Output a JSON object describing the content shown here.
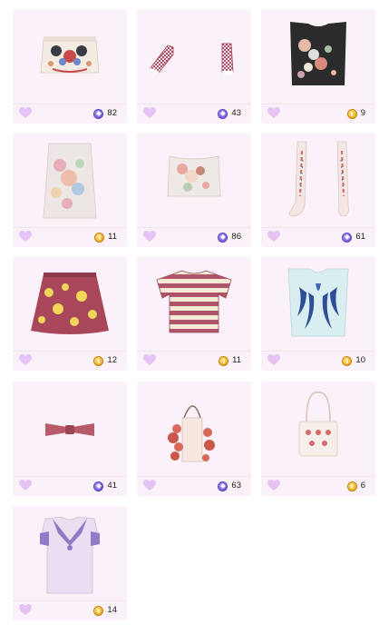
{
  "items": [
    {
      "name": "embroidered-top",
      "price": "82",
      "currency": "diamond"
    },
    {
      "name": "checkered-sneakers",
      "price": "43",
      "currency": "diamond"
    },
    {
      "name": "floral-black-tank",
      "price": "9",
      "currency": "gold"
    },
    {
      "name": "floral-pencil-skirt",
      "price": "11",
      "currency": "gold"
    },
    {
      "name": "floral-tube-top",
      "price": "86",
      "currency": "diamond"
    },
    {
      "name": "knee-high-socks",
      "price": "61",
      "currency": "diamond"
    },
    {
      "name": "yellow-floral-skirt",
      "price": "12",
      "currency": "gold"
    },
    {
      "name": "striped-crop-top",
      "price": "11",
      "currency": "gold"
    },
    {
      "name": "blue-leaf-vest",
      "price": "10",
      "currency": "gold"
    },
    {
      "name": "bow-choker",
      "price": "41",
      "currency": "diamond"
    },
    {
      "name": "red-fringe-handbag",
      "price": "63",
      "currency": "diamond"
    },
    {
      "name": "white-crossbody-bag",
      "price": "6",
      "currency": "gold"
    },
    {
      "name": "sailor-dress",
      "price": "14",
      "currency": "gold"
    }
  ],
  "colors": {
    "card_bg": "#fbf1f8",
    "heart": "#e5c3f4",
    "gold": "#f0b634",
    "diamond": "#7b63dc"
  }
}
